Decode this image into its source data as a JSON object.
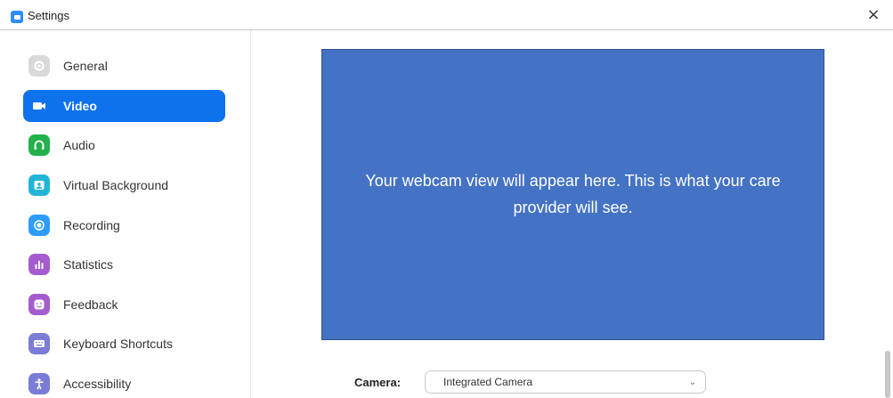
{
  "window": {
    "title": "Settings",
    "close_glyph": "×"
  },
  "sidebar": {
    "items": [
      {
        "label": "General",
        "icon": "gear-icon",
        "color": "#cccccc",
        "active": false
      },
      {
        "label": "Video",
        "icon": "video-camera-icon",
        "color": "#0e72ed",
        "active": true
      },
      {
        "label": "Audio",
        "icon": "headphones-icon",
        "color": "#22b14c",
        "active": false
      },
      {
        "label": "Virtual Background",
        "icon": "person-card-icon",
        "color": "#22b5d8",
        "active": false
      },
      {
        "label": "Recording",
        "icon": "record-icon",
        "color": "#2d9cff",
        "active": false
      },
      {
        "label": "Statistics",
        "icon": "bar-chart-icon",
        "color": "#a45ccf",
        "active": false
      },
      {
        "label": "Feedback",
        "icon": "smiley-icon",
        "color": "#a45ccf",
        "active": false
      },
      {
        "label": "Keyboard Shortcuts",
        "icon": "keyboard-icon",
        "color": "#7b7bd8",
        "active": false
      },
      {
        "label": "Accessibility",
        "icon": "accessibility-icon",
        "color": "#7b7bd8",
        "active": false
      }
    ]
  },
  "main": {
    "preview_text": "Your webcam view will appear here. This is what your care provider will see.",
    "camera": {
      "label": "Camera:",
      "selected": "Integrated Camera"
    }
  }
}
